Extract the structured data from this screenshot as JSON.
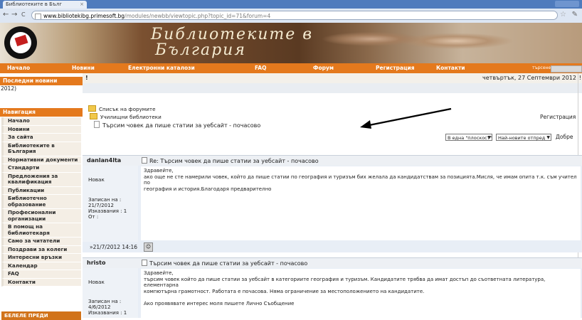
{
  "browser": {
    "tab_title": "Библиотеките в Бълг",
    "tab_close": "×",
    "back": "←",
    "forward": "→",
    "reload": "C",
    "url_host": "www.bibliotekibg.primesoft.bg",
    "url_path": "/modules/newbb/viewtopic.php?topic_id=71&forum=4"
  },
  "header": {
    "title_line1": "Библиотеките в",
    "title_line2": "България"
  },
  "menu": {
    "items": [
      "Начало",
      "Новини",
      "Електронни каталози",
      "FAQ",
      "Форум",
      "Регистрация",
      "Контакти"
    ],
    "search_label": "търсене »"
  },
  "sidebar": {
    "news_title": "Последни новини",
    "news_text": "2012)",
    "nav_title": "Навигация",
    "nav_items": [
      "Начало",
      "Новини",
      "За сайта",
      "Библиотеките в България",
      "Нормативни документи",
      "Стандарти",
      "Предложения за квалификация",
      "Публикации",
      "Библиотечно образование",
      "Професионални организации",
      "В помощ на библиотекаря",
      "Само за читатели",
      "Поздрави за колеги",
      "Интересни връзки",
      "Календар",
      "FAQ",
      "Контакти"
    ],
    "banner_text": "БЕЛЕЛЕ ПРЕДИ"
  },
  "datebar": {
    "marker": "!",
    "date": "четвъртък, 27 Септември 2012",
    "marker_right": "!"
  },
  "forum": {
    "crumbs": [
      "Списък на форумите",
      "Училищни библиотеки",
      "Търсим човек да пише статии за уебсайт - почасово"
    ],
    "register_link": "Регистрация",
    "view_mode": "В една \"плоскост\"",
    "order": "Най-новите отпред",
    "go_button": "Добре"
  },
  "posts": [
    {
      "author": "danlan4lta",
      "title": "Re: Търсим човек да пише статии за уебсайт - почасово",
      "rank": "Новак",
      "meta": [
        "Записан на :",
        "21/7/2012",
        "Изказвания : 1",
        "От :"
      ],
      "body": [
        "Здравейте,",
        "ако още не сте намерили човек, който да пише статии по география и туризъм бих желала да кандидатствам за позицията.Мисля, че имам опита т.к. съм учител по",
        "география и история.Благодаря предварително"
      ],
      "time": "»21/7/2012 14:16"
    },
    {
      "author": "hristo",
      "title": "Търсим човек да пише статии за уебсайт - почасово",
      "rank": "Новак",
      "meta": [
        "Записан на :",
        "4/6/2012",
        "Изказвания : 1"
      ],
      "body": [
        "Здравейте,",
        "търсим човек който да пише статии за уебсайт в категориите география и туризъм. Кандидатите трябва да имат достъп до съответната литература, елементарна",
        "компютърна грамотност. Работата е почасова. Няма ограничение за местоположението на кандидатите."
      ],
      "body2": "Ако проявявате интерес моля пишете Лично Съобщение"
    }
  ]
}
